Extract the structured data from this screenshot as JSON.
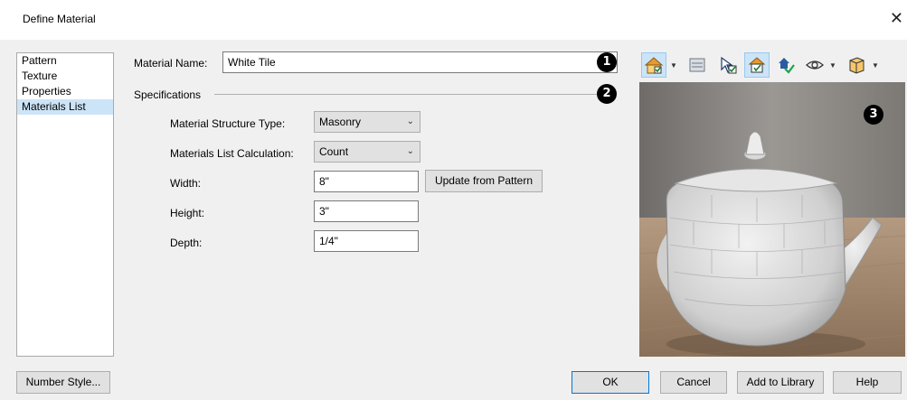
{
  "window": {
    "title": "Define Material",
    "close_glyph": "✕"
  },
  "nav": {
    "items": [
      {
        "label": "Pattern",
        "selected": false
      },
      {
        "label": "Texture",
        "selected": false
      },
      {
        "label": "Properties",
        "selected": false
      },
      {
        "label": "Materials List",
        "selected": true
      }
    ]
  },
  "material_name": {
    "label": "Material Name:",
    "value": "White Tile"
  },
  "specifications": {
    "heading": "Specifications",
    "structure_type": {
      "label": "Material Structure Type:",
      "value": "Masonry"
    },
    "calculation": {
      "label": "Materials List Calculation:",
      "value": "Count"
    },
    "width": {
      "label": "Width:",
      "value": "8\""
    },
    "height": {
      "label": "Height:",
      "value": "3\""
    },
    "depth": {
      "label": "Depth:",
      "value": "1/4\""
    },
    "update_button": "Update from Pattern"
  },
  "callouts": [
    "1",
    "2",
    "3"
  ],
  "toolbar": {
    "icons": [
      "house-view-icon",
      "layers-icon",
      "select-objects-icon",
      "material-check-icon",
      "render-check-icon",
      "eye-icon",
      "box-icon"
    ]
  },
  "buttons": {
    "number_style": "Number Style...",
    "ok": "OK",
    "cancel": "Cancel",
    "add_to_library": "Add to Library",
    "help": "Help"
  },
  "colors": {
    "accent": "#0078d7",
    "selection": "#cce4f7"
  }
}
